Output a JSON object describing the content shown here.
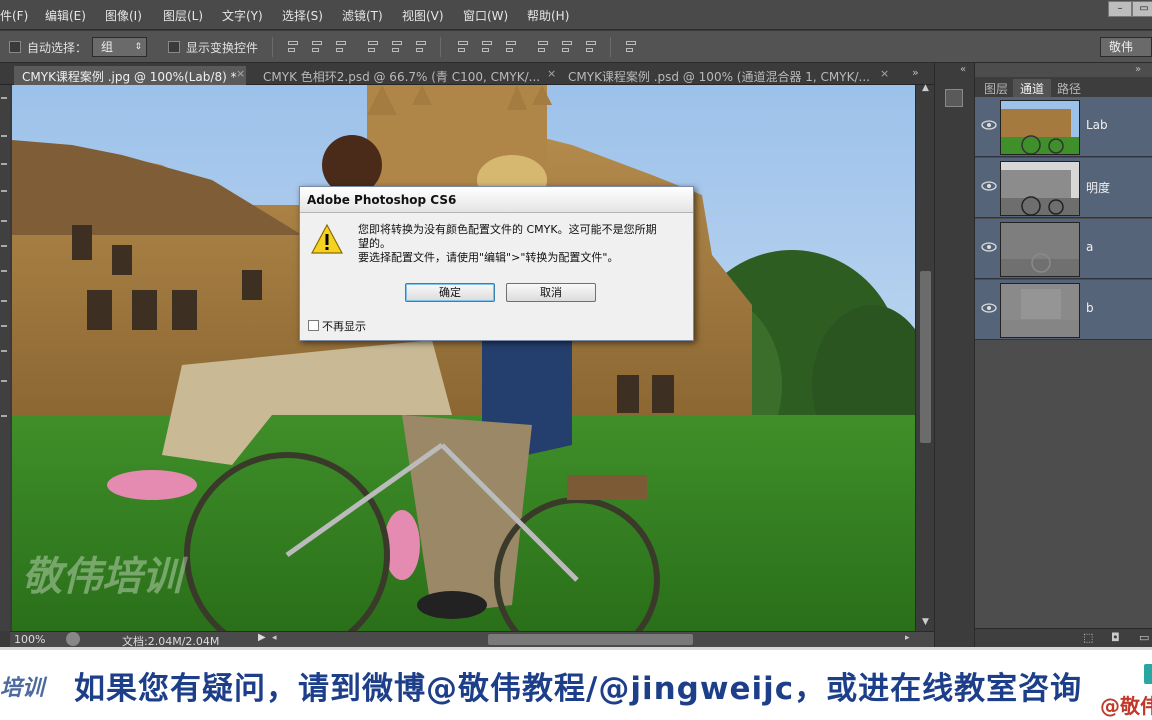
{
  "menubar": {
    "items": [
      "件(F)",
      "编辑(E)",
      "图像(I)",
      "图层(L)",
      "文字(Y)",
      "选择(S)",
      "滤镜(T)",
      "视图(V)",
      "窗口(W)",
      "帮助(H)"
    ]
  },
  "options": {
    "auto_select_label": "自动选择：",
    "auto_select_value": "组",
    "show_transform_label": "显示变换控件",
    "workspace": "敬伟"
  },
  "tabs": [
    {
      "label": "CMYK课程案例 .jpg @ 100%(Lab/8) *",
      "active": true
    },
    {
      "label": "CMYK 色相环2.psd @ 66.7% (青   C100, CMYK/...",
      "active": false
    },
    {
      "label": "CMYK课程案例 .psd @ 100% (通道混合器 1, CMYK/...",
      "active": false
    }
  ],
  "status": {
    "zoom": "100%",
    "doc_info": "文档:2.04M/2.04M"
  },
  "panel": {
    "tabs": [
      "图层",
      "通道",
      "路径"
    ],
    "active_tab": "通道",
    "channels": [
      "Lab",
      "明度",
      "a",
      "b"
    ]
  },
  "dialog": {
    "title": "Adobe Photoshop CS6",
    "line1": "您即将转换为没有颜色配置文件的 CMYK。这可能不是您所期",
    "line2": "望的。",
    "line3": "要选择配置文件，请使用\"编辑\">\"转换为配置文件\"。",
    "ok": "确定",
    "cancel": "取消",
    "dont_show": "不再显示"
  },
  "watermark": "敬伟培训",
  "subtitle": {
    "text": "如果您有疑问，请到微博@敬伟教程/@jingweijc，或进在线教室咨询",
    "logo_left": "培训",
    "logo_right": "@敬伟"
  }
}
